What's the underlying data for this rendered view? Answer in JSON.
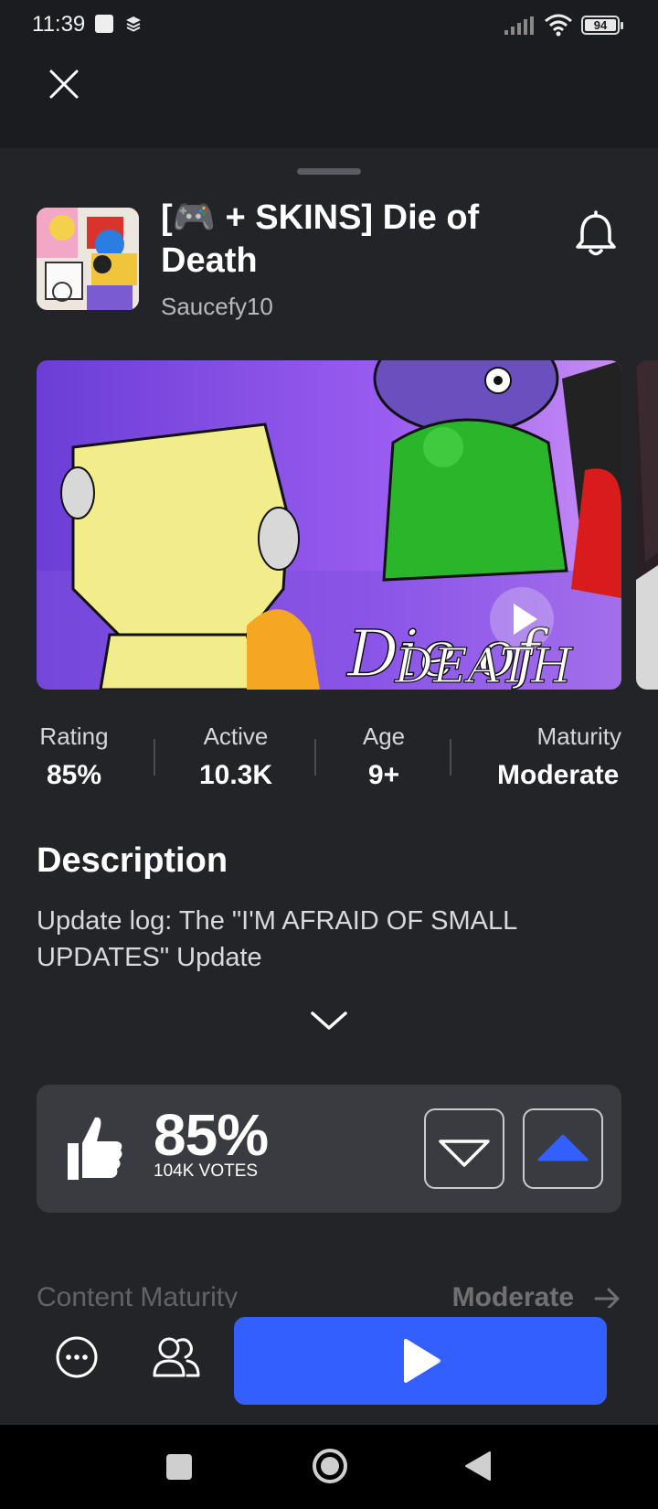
{
  "status_bar": {
    "time": "11:39",
    "battery": "94",
    "icons": [
      "upload-icon",
      "layers-icon",
      "signal-icon",
      "wifi-icon",
      "battery-icon"
    ]
  },
  "header": {
    "close_icon": "close-icon"
  },
  "game": {
    "title": "[🎮 + SKINS] Die of Death",
    "creator": "Saucefy10",
    "bell_icon": "bell-icon"
  },
  "stats": [
    {
      "label": "Rating",
      "value": "85%"
    },
    {
      "label": "Active",
      "value": "10.3K"
    },
    {
      "label": "Age",
      "value": "9+"
    },
    {
      "label": "Maturity",
      "value": "Moderate"
    }
  ],
  "description": {
    "title": "Description",
    "text": "Update log: The \"I'M AFRAID OF SMALL UPDATES\" Update"
  },
  "votes": {
    "percent": "85%",
    "count": "104K VOTES"
  },
  "content_maturity": {
    "label": "Content Maturity",
    "value": "Moderate"
  },
  "colors": {
    "accent": "#335fff",
    "background": "#232428",
    "card": "#393b41"
  }
}
